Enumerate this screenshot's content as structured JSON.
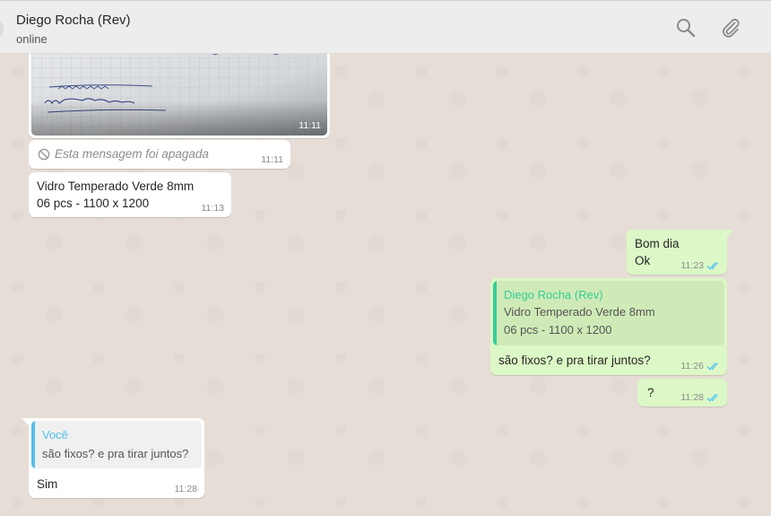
{
  "header": {
    "contact_name": "Diego Rocha (Rev)",
    "status": "online",
    "search_icon": "search-icon",
    "attach_icon": "paperclip-icon"
  },
  "colors": {
    "outgoing_bubble": "#dcf8c6",
    "incoming_bubble": "#ffffff",
    "quote_name_outgoing": "#35cd96",
    "quote_name_incoming": "#53bdeb",
    "read_ticks": "#4fc3f7"
  },
  "messages": [
    {
      "direction": "incoming",
      "type": "image",
      "time": "11:11"
    },
    {
      "direction": "incoming",
      "type": "deleted",
      "text": "Esta mensagem foi apagada",
      "time": "11:11",
      "icon": "prohibited-icon"
    },
    {
      "direction": "incoming",
      "type": "text",
      "lines": [
        "Vidro Temperado Verde 8mm",
        "06 pcs - 1100 x 1200"
      ],
      "time": "11:13"
    },
    {
      "direction": "outgoing",
      "type": "text",
      "lines": [
        "Bom dia",
        "Ok"
      ],
      "time": "11:23",
      "status": "read"
    },
    {
      "direction": "outgoing",
      "type": "reply",
      "quote": {
        "author": "Diego Rocha (Rev)",
        "lines": [
          "Vidro Temperado Verde 8mm",
          "06 pcs - 1100 x 1200"
        ]
      },
      "text": "são fixos? e pra tirar juntos?",
      "time": "11:26",
      "status": "read"
    },
    {
      "direction": "outgoing",
      "type": "text",
      "lines": [
        "?"
      ],
      "time": "11:28",
      "status": "read"
    },
    {
      "direction": "incoming",
      "type": "reply",
      "quote": {
        "author": "Você",
        "lines": [
          "são fixos? e pra tirar juntos?"
        ]
      },
      "text": "Sim",
      "time": "11:28"
    }
  ]
}
